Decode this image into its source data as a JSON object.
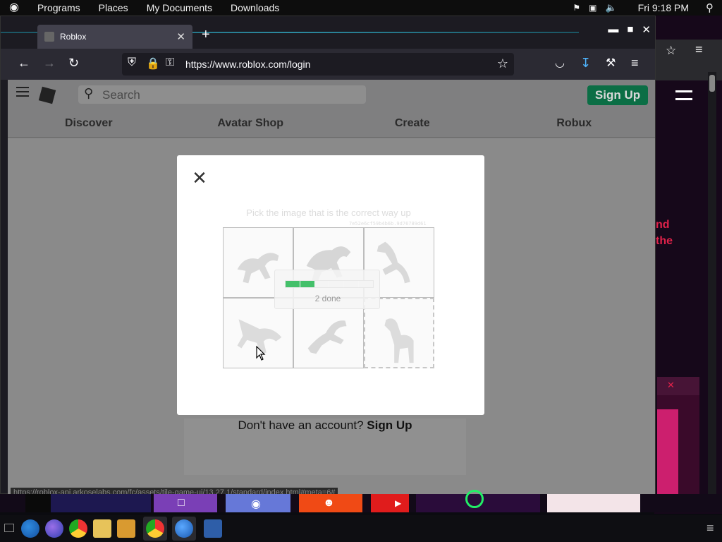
{
  "topbar": {
    "menus": [
      "Programs",
      "Places",
      "My Documents",
      "Downloads"
    ],
    "clock": "Fri 9:18 PM"
  },
  "browser": {
    "tab_title": "Roblox",
    "url_display": "https://www.roblox.com/login",
    "status_url": "https://roblox-api.arkoselabs.com/fc/assets/tile-game-ui/13.27.1/standard/index.html#meta=6#"
  },
  "roblox": {
    "search_placeholder": "Search",
    "signup_button": "Sign Up",
    "nav": [
      "Discover",
      "Avatar Shop",
      "Create",
      "Robux"
    ],
    "no_account_text": "Don't have an account?",
    "no_account_link": "Sign Up"
  },
  "captcha": {
    "prompt": "Pick the image that is the correct way up",
    "game_id": "7e52e6cf59b4b6b.9d76789d61",
    "progress_total": 6,
    "progress_done": 2,
    "progress_label": "2 done"
  },
  "background_window": {
    "text_line1": "nd",
    "text_line2": "the"
  },
  "colors": {
    "roblox_green": "#0b6e45",
    "progress_green": "#44c06a",
    "firefox_dark": "#1c1b22",
    "opera_red": "#e0224a"
  }
}
